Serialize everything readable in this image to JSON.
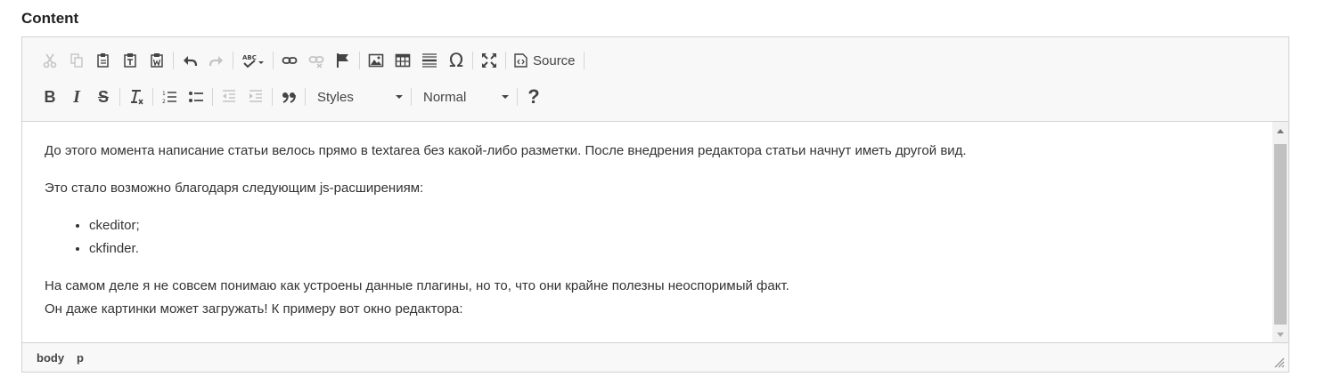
{
  "label": "Content",
  "toolbar": {
    "source_label": "Source",
    "styles_combo": "Styles",
    "format_combo": "Normal",
    "icons": {
      "cut": "cut-icon",
      "copy": "copy-icon",
      "paste": "paste-icon",
      "paste_text": "paste-text-icon",
      "paste_word": "paste-word-icon",
      "undo": "undo-icon",
      "redo": "redo-icon",
      "spellcheck": "spellcheck-icon",
      "link": "link-icon",
      "unlink": "unlink-icon",
      "anchor": "anchor-flag-icon",
      "image": "image-icon",
      "table": "table-icon",
      "hr": "horizontal-line-icon",
      "special_char": "omega-icon",
      "maximize": "maximize-icon",
      "bold": "bold-icon",
      "italic": "italic-icon",
      "strike": "strike-icon",
      "remove_format": "remove-format-icon",
      "numbered_list": "numbered-list-icon",
      "bulleted_list": "bulleted-list-icon",
      "outdent": "outdent-icon",
      "indent": "indent-icon",
      "blockquote": "blockquote-icon",
      "help": "help-icon"
    },
    "glyphs": {
      "special_char": "Ω",
      "bold": "B",
      "italic": "I",
      "strike": "S",
      "help": "?",
      "remove_format": "I"
    }
  },
  "content": {
    "paragraph_1": "До этого момента написание статьи велось прямо в textarea без какой-либо разметки. После внедрения редактора статьи начнут иметь другой вид.",
    "paragraph_2": "Это стало возможно благодаря следующим js-расширениям:",
    "list_items": [
      "ckeditor;",
      "ckfinder."
    ],
    "paragraph_3_line_1": "На самом деле я не совсем понимаю как устроены данные плагины, но то, что они крайне полезны неоспоримый факт.",
    "paragraph_3_line_2": "Он даже картинки может загружать! К примеру вот окно редактора:"
  },
  "footer": {
    "path": [
      "body",
      "p"
    ]
  },
  "colors": {
    "toolbar_bg": "#f8f8f8",
    "border": "#d1d1d1",
    "icon": "#444444",
    "icon_disabled": "#c4c4c4",
    "scroll_thumb": "#c1c1c1"
  }
}
